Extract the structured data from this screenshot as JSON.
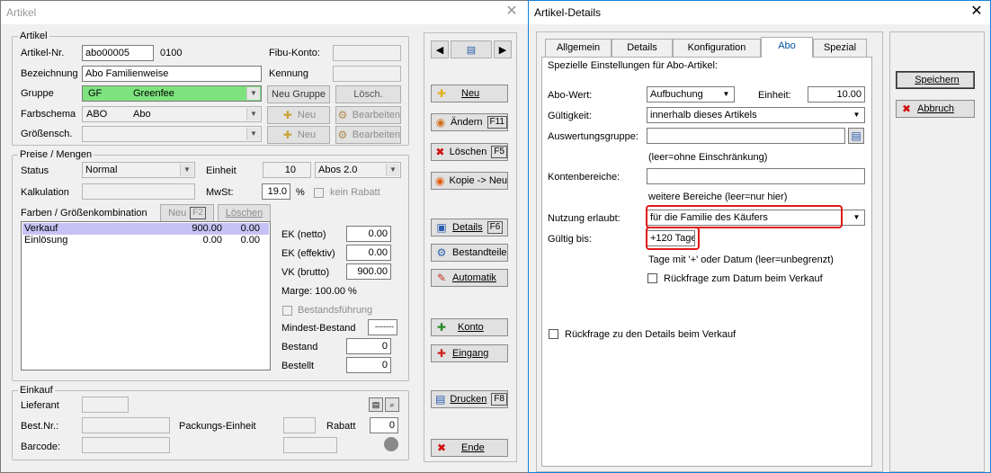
{
  "artikel": {
    "title": "Artikel",
    "grp_artikel": "Artikel",
    "lbl_artnr": "Artikel-Nr.",
    "artnr": "abo00005",
    "artnr_suffix": "0100",
    "lbl_fibu": "Fibu-Konto:",
    "lbl_bezeichnung": "Bezeichnung",
    "bezeichnung": "Abo Familienweise",
    "lbl_kennung": "Kennung",
    "lbl_gruppe": "Gruppe",
    "gruppe_code": "GF",
    "gruppe_name": "Greenfee",
    "btn_neu_gruppe": "Neu Gruppe",
    "btn_loesch": "Lösch.",
    "lbl_farbschema": "Farbschema",
    "farbschema_code": "ABO",
    "farbschema_name": "Abo",
    "btn_neu": "Neu",
    "btn_bearbeiten": "Bearbeiten",
    "lbl_groessensch": "Größensch.",
    "grp_preise": "Preise / Mengen",
    "lbl_status": "Status",
    "status": "Normal",
    "lbl_einheit": "Einheit",
    "einheit_qty": "10",
    "einheit": "Abos 2.0",
    "lbl_kalkulation": "Kalkulation",
    "lbl_mwst": "MwSt:",
    "mwst": "19.0",
    "pct": "%",
    "kein_rabatt": "kein Rabatt",
    "lbl_farben": "Farben / Größenkombination",
    "btn_neu_f2": "Neu",
    "key_f2": "F2",
    "btn_loeschen_small": "Löschen",
    "rows": [
      {
        "name": "Verkauf",
        "a": "900.00",
        "b": "0.00"
      },
      {
        "name": "Einlösung",
        "a": "0.00",
        "b": "0.00"
      }
    ],
    "lbl_ek_netto": "EK (netto)",
    "ek_netto": "0.00",
    "lbl_ek_effektiv": "EK (effektiv)",
    "ek_effektiv": "0.00",
    "lbl_vk_brutto": "VK (brutto)",
    "vk_brutto": "900.00",
    "marge": "Marge: 100.00 %",
    "bestandsfuehrung": "Bestandsführung",
    "lbl_mindest": "Mindest-Bestand",
    "mindest": "-------",
    "lbl_bestand": "Bestand",
    "bestand": "0",
    "lbl_bestellt": "Bestellt",
    "bestellt": "0",
    "grp_einkauf": "Einkauf",
    "lbl_lieferant": "Lieferant",
    "lbl_bestnr": "Best.Nr.:",
    "lbl_packungs": "Packungs-Einheit",
    "lbl_rabatt": "Rabatt",
    "rabatt": "0",
    "lbl_barcode": "Barcode:",
    "toolbar": {
      "neu": "Neu",
      "aendern": "Ändern",
      "key_f11": "F11",
      "loeschen": "Löschen",
      "key_f5": "F5",
      "kopie": "Kopie -> Neu",
      "details": "Details",
      "key_f6": "F6",
      "bestandteile": "Bestandteile",
      "automatik": "Automatik",
      "konto": "Konto",
      "eingang": "Eingang",
      "drucken": "Drucken",
      "key_f8": "F8",
      "ende": "Ende"
    }
  },
  "details": {
    "title": "Artikel-Details",
    "tabs": [
      "Allgemein",
      "Details",
      "Konfiguration",
      "Abo",
      "Spezial"
    ],
    "heading": "Spezielle Einstellungen für Abo-Artikel:",
    "lbl_abowert": "Abo-Wert:",
    "abowert": "Aufbuchung",
    "lbl_einheit": "Einheit:",
    "einheit": "10.00",
    "lbl_gueltigkeit": "Gültigkeit:",
    "gueltigkeit": "innerhalb dieses Artikels",
    "lbl_auswertung": "Auswertungsgruppe:",
    "hint_leer": "(leer=ohne Einschränkung)",
    "lbl_konten": "Kontenbereiche:",
    "hint_bereiche": "weitere Bereiche (leer=nur hier)",
    "lbl_nutzung": "Nutzung erlaubt:",
    "nutzung": "für die Familie des Käufers",
    "lbl_gueltig_bis": "Gültig bis:",
    "gueltig_bis": "+120 Tage",
    "hint_tage": "Tage mit '+' oder Datum (leer=unbegrenzt)",
    "rueckfrage_datum": "Rückfrage zum Datum beim Verkauf",
    "rueckfrage_details": "Rückfrage zu den Details beim Verkauf",
    "btn_speichern": "Speichern",
    "btn_abbruch": "Abbruch"
  },
  "colors": {
    "accent_green": "#7ee37e",
    "selection": "#c7c2f5",
    "highlight_red": "#e01818"
  }
}
